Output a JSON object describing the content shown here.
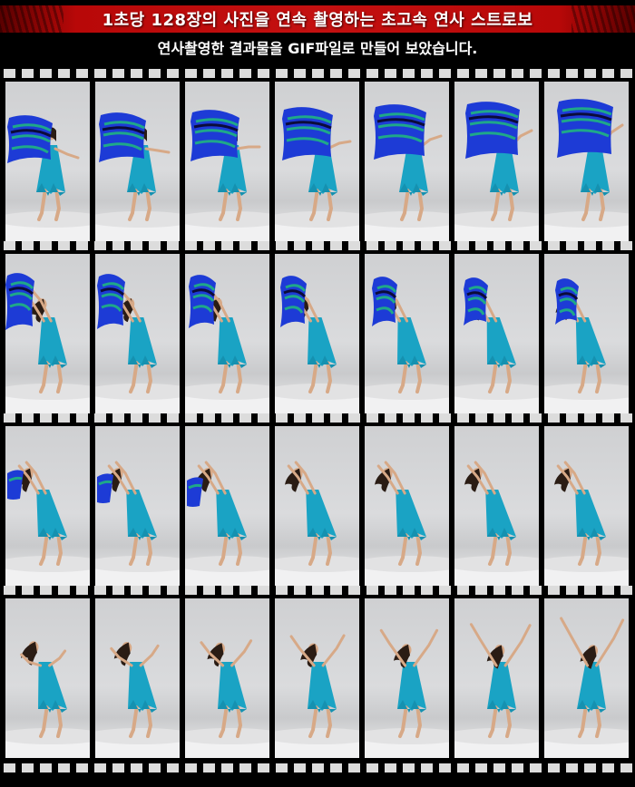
{
  "header": {
    "title": "1초당 128장의 사진을 연속 촬영하는 초고속 연사 스트로보",
    "subtitle": "연사촬영한 결과물을 GIF파일로 만들어 보았습니다."
  },
  "colors": {
    "title_red": "#c41010",
    "film_black": "#000000",
    "perforation": "#dcdcdc",
    "dress": "#1aa3c4",
    "scarf_blue": "#1d3bd6",
    "scarf_green": "#1fa889",
    "skin": "#d7a987",
    "hair": "#2a1c14",
    "backdrop": "#d4d5d7",
    "floor": "#f1f1f2"
  },
  "rows": [
    {
      "label": "row-1",
      "scarf": true,
      "frames": 7
    },
    {
      "label": "row-2",
      "scarf": true,
      "frames": 7
    },
    {
      "label": "row-3",
      "scarf": "partial",
      "frames": 7
    },
    {
      "label": "row-4",
      "scarf": false,
      "frames": 7
    }
  ]
}
